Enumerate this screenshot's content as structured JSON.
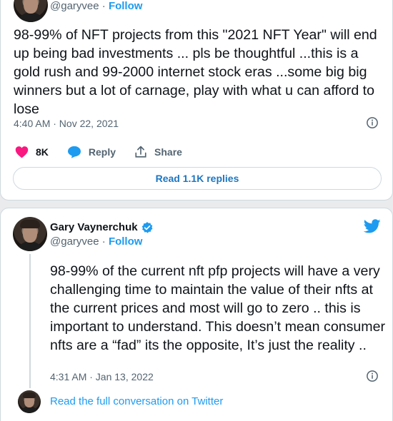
{
  "tweet1": {
    "handle": "@garyvee",
    "separator": " · ",
    "follow_label": "Follow",
    "text": "98-99% of NFT projects from this \"2021 NFT Year\" will end up being bad investments ... pls be thoughtful ...this is a gold rush and 99-2000 internet stock eras ...some big big winners but a lot of carnage, play with what u can afford to lose",
    "timestamp": "4:40 AM · Nov 22, 2021",
    "likes": "8K",
    "reply_label": "Reply",
    "share_label": "Share",
    "read_replies_label": "Read 1.1K replies"
  },
  "tweet2": {
    "name": "Gary Vaynerchuk",
    "handle": "@garyvee",
    "separator": " · ",
    "follow_label": "Follow",
    "text": "98-99% of the current nft pfp projects will have a very challenging time to maintain the value of their nfts at the current prices and most will go to zero .. this is important to understand. This doesn’t mean consumer nfts are a “fad” its the opposite, It’s just the reality ..",
    "timestamp": "4:31 AM · Jan 13, 2022",
    "read_full_label": "Read the full conversation on Twitter"
  },
  "colors": {
    "accent": "#1d9bf0",
    "like": "#f91880",
    "text": "#0f1419",
    "muted": "#536471"
  },
  "icons": [
    "info-icon",
    "heart-icon",
    "reply-bubble-icon",
    "share-icon",
    "verified-badge-icon",
    "twitter-bird-icon"
  ]
}
